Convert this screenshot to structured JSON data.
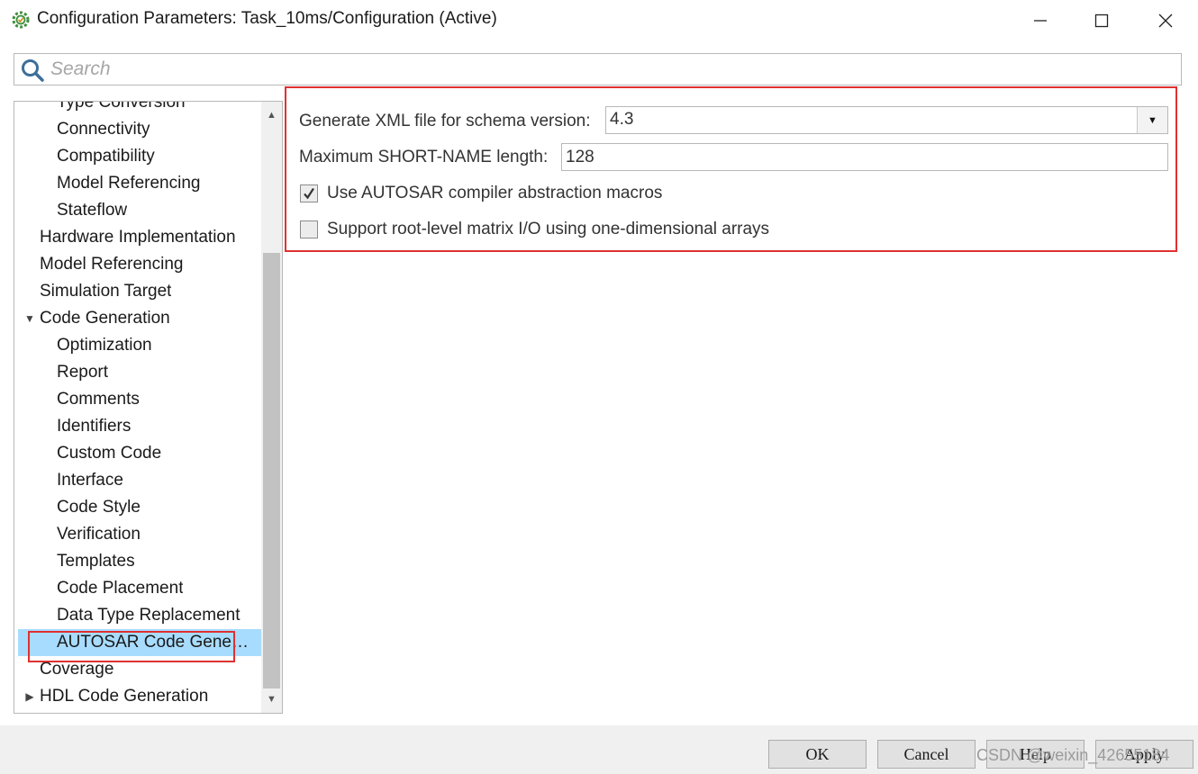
{
  "window": {
    "title": "Configuration Parameters: Task_10ms/Configuration (Active)",
    "minimize_icon": "minimize-icon",
    "maximize_icon": "maximize-icon",
    "close_icon": "close-icon"
  },
  "search": {
    "placeholder": "Search",
    "value": ""
  },
  "tree": {
    "items": [
      {
        "label": "Type Conversion",
        "level": 2
      },
      {
        "label": "Connectivity",
        "level": 2
      },
      {
        "label": "Compatibility",
        "level": 2
      },
      {
        "label": "Model Referencing",
        "level": 2
      },
      {
        "label": "Stateflow",
        "level": 2
      },
      {
        "label": "Hardware Implementation",
        "level": 1
      },
      {
        "label": "Model Referencing",
        "level": 1
      },
      {
        "label": "Simulation Target",
        "level": 1
      },
      {
        "label": "Code Generation",
        "level": 1,
        "expanded": true
      },
      {
        "label": "Optimization",
        "level": 2
      },
      {
        "label": "Report",
        "level": 2
      },
      {
        "label": "Comments",
        "level": 2
      },
      {
        "label": "Identifiers",
        "level": 2
      },
      {
        "label": "Custom Code",
        "level": 2
      },
      {
        "label": "Interface",
        "level": 2
      },
      {
        "label": "Code Style",
        "level": 2
      },
      {
        "label": "Verification",
        "level": 2
      },
      {
        "label": "Templates",
        "level": 2
      },
      {
        "label": "Code Placement",
        "level": 2
      },
      {
        "label": "Data Type Replacement",
        "level": 2
      },
      {
        "label": "AUTOSAR Code Gene…",
        "level": 2,
        "selected": true
      },
      {
        "label": "Coverage",
        "level": 1
      },
      {
        "label": "HDL Code Generation",
        "level": 1,
        "expanded": false
      }
    ]
  },
  "settings": {
    "schema_label": "Generate XML file for schema version:",
    "schema_value": "4.3",
    "short_name_label": "Maximum SHORT-NAME length:",
    "short_name_value": "128",
    "compiler_macros_label": "Use AUTOSAR compiler abstraction macros",
    "compiler_macros_checked": true,
    "matrix_io_label": "Support root-level matrix I/O using one-dimensional arrays",
    "matrix_io_checked": false
  },
  "buttons": {
    "ok": "OK",
    "cancel": "Cancel",
    "help": "Help",
    "apply": "Apply"
  },
  "watermark": "CSDN @weixin_42655184",
  "colors": {
    "selection": "#a8dcff",
    "highlight_box": "#e03030"
  }
}
